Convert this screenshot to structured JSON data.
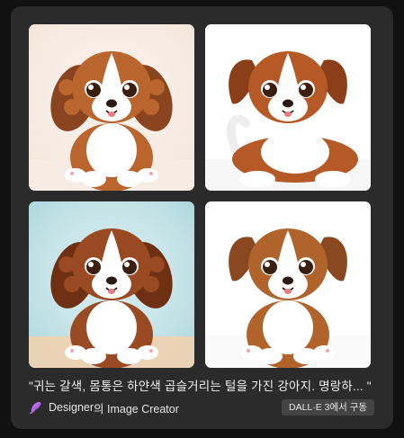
{
  "images": [
    {
      "name": "puppy-image-1",
      "bg": "#f3e3d6",
      "floor": "#f6ece4",
      "coat": "#b9652d",
      "accent": "#8a4520",
      "style": "curly"
    },
    {
      "name": "puppy-image-2",
      "bg": "#ffffff",
      "floor": "#f6f6f6",
      "coat": "#b55a26",
      "accent": "#8a3f18",
      "style": "lying"
    },
    {
      "name": "puppy-image-3",
      "bg": "#a9d6dc",
      "floor": "#f0d2b0",
      "coat": "#9a4a22",
      "accent": "#6e2f12",
      "style": "curly"
    },
    {
      "name": "puppy-image-4",
      "bg": "#ffffff",
      "floor": "#f8f8f8",
      "coat": "#b0642c",
      "accent": "#8a4820",
      "style": "sitting"
    }
  ],
  "caption": "\"귀는 갈색, 몸통은 하얀색 곱슬거리는 털을 가진 강아지. 명랑하...  \"",
  "credit": {
    "brand": "Designer",
    "suffix": "의 Image Creator",
    "logo_icon": "designer-logo-icon"
  },
  "model_badge": "DALL·E 3에서 구동",
  "colors": {
    "card_bg": "#2b2b2b",
    "page_bg": "#111111",
    "badge_bg": "#444444"
  }
}
